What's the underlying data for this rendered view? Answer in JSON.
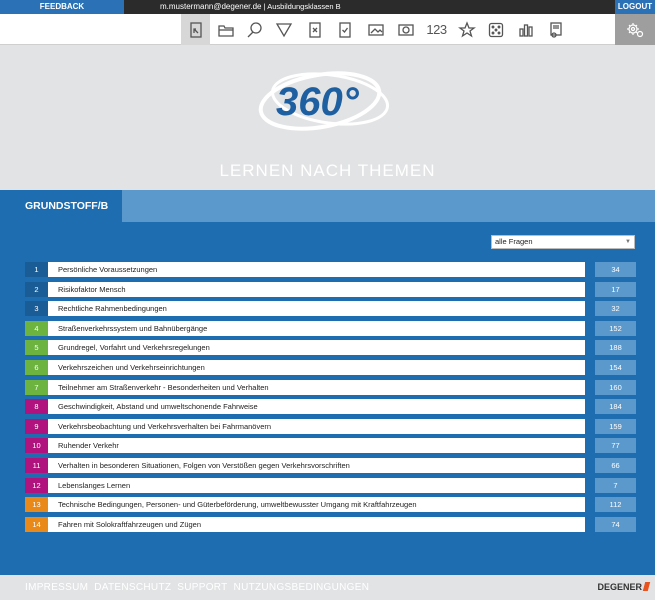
{
  "topbar": {
    "feedback_label": "FEEDBACK",
    "user_email": "m.mustermann@degener.de",
    "user_class": "Ausbildungsklassen B",
    "logout_label": "LOGOUT"
  },
  "toolbar": {
    "icons": [
      "card-edit-icon",
      "folder-icon",
      "search-icon",
      "filter-icon",
      "wrong-card-icon",
      "check-card-icon",
      "image-card-icon",
      "video-card-icon",
      "numbers-icon",
      "star-icon",
      "dice-icon",
      "bar-chart-icon",
      "certificate-icon"
    ],
    "numbers_label": "123",
    "active_tool": "card-edit-icon"
  },
  "hero": {
    "logo_text": "360°",
    "title": "LERNEN NACH THEMEN"
  },
  "section": {
    "title": "GRUNDSTOFF/B"
  },
  "filter": {
    "selected": "alle Fragen"
  },
  "colors": {
    "blue": "#1a5d96",
    "green": "#6cb33f",
    "magenta": "#b0137e",
    "orange": "#e8891a"
  },
  "topics": [
    {
      "num": "1",
      "label": "Persönliche Voraussetzungen",
      "count": "34",
      "color": "#1a5d96"
    },
    {
      "num": "2",
      "label": "Risikofaktor Mensch",
      "count": "17",
      "color": "#1a5d96"
    },
    {
      "num": "3",
      "label": "Rechtliche Rahmenbedingungen",
      "count": "32",
      "color": "#1a5d96"
    },
    {
      "num": "4",
      "label": "Straßenverkehrssystem und Bahnübergänge",
      "count": "152",
      "color": "#6cb33f"
    },
    {
      "num": "5",
      "label": "Grundregel, Vorfahrt und Verkehrsregelungen",
      "count": "188",
      "color": "#6cb33f"
    },
    {
      "num": "6",
      "label": "Verkehrszeichen und Verkehrseinrichtungen",
      "count": "154",
      "color": "#6cb33f"
    },
    {
      "num": "7",
      "label": "Teilnehmer am Straßenverkehr - Besonderheiten und Verhalten",
      "count": "160",
      "color": "#6cb33f"
    },
    {
      "num": "8",
      "label": "Geschwindigkeit, Abstand und umweltschonende Fahrweise",
      "count": "184",
      "color": "#b0137e"
    },
    {
      "num": "9",
      "label": "Verkehrsbeobachtung und Verkehrsverhalten bei Fahrmanövern",
      "count": "159",
      "color": "#b0137e"
    },
    {
      "num": "10",
      "label": "Ruhender Verkehr",
      "count": "77",
      "color": "#b0137e"
    },
    {
      "num": "11",
      "label": "Verhalten in besonderen Situationen, Folgen von Verstößen gegen Verkehrsvorschriften",
      "count": "66",
      "color": "#b0137e"
    },
    {
      "num": "12",
      "label": "Lebenslanges Lernen",
      "count": "7",
      "color": "#b0137e"
    },
    {
      "num": "13",
      "label": "Technische Bedingungen, Personen- und Güterbeförderung, umweltbewusster Umgang mit Kraftfahrzeugen",
      "count": "112",
      "color": "#e8891a"
    },
    {
      "num": "14",
      "label": "Fahren mit Solokraftfahrzeugen und Zügen",
      "count": "74",
      "color": "#e8891a"
    }
  ],
  "footer": {
    "links": [
      "IMPRESSUM",
      "DATENSCHUTZ",
      "SUPPORT",
      "NUTZUNGSBEDINGUNGEN"
    ],
    "brand": "DEGENER"
  }
}
